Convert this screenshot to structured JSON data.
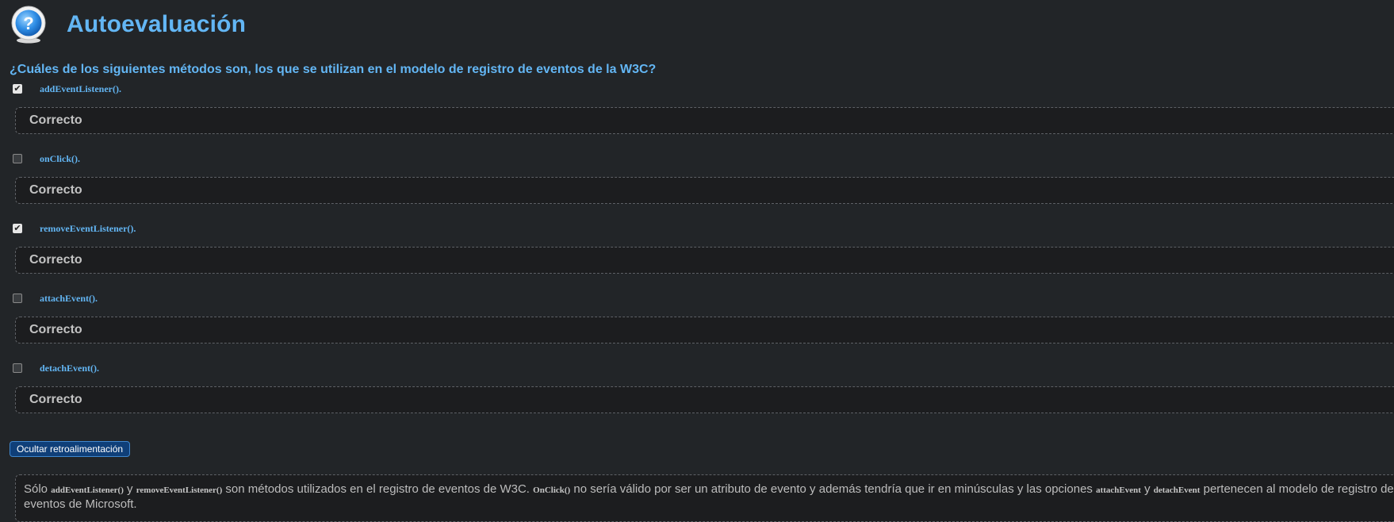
{
  "header": {
    "icon": "question-help-icon",
    "title": "Autoevaluación"
  },
  "question": "¿Cuáles de los siguientes métodos son, los que se utilizan en el modelo de registro de eventos de la W3C?",
  "options": [
    {
      "label": "addEventListener().",
      "checked": true,
      "feedback": "Correcto"
    },
    {
      "label": "onClick().",
      "checked": false,
      "feedback": "Correcto"
    },
    {
      "label": "removeEventListener().",
      "checked": true,
      "feedback": "Correcto"
    },
    {
      "label": "attachEvent().",
      "checked": false,
      "feedback": "Correcto"
    },
    {
      "label": "detachEvent().",
      "checked": false,
      "feedback": "Correcto"
    }
  ],
  "toggle_button": "Ocultar retroalimentación",
  "retro": {
    "p1": "Sólo ",
    "c1": "addEventListener()",
    "p2": " y ",
    "c2": "removeEventListener()",
    "p3": " son métodos utilizados en el registro de eventos de W3C. ",
    "c3": "OnClick()",
    "p4": " no sería válido por ser un atributo de evento y además tendría que ir en minúsculas y las opciones ",
    "c4": "attachEvent",
    "p5": " y ",
    "c5": "detachEvent",
    "p6": " pertenecen al modelo de registro de eventos de Microsoft."
  },
  "colors": {
    "background": "#222528",
    "accent": "#63b6f4",
    "button": "#0f3f79"
  }
}
